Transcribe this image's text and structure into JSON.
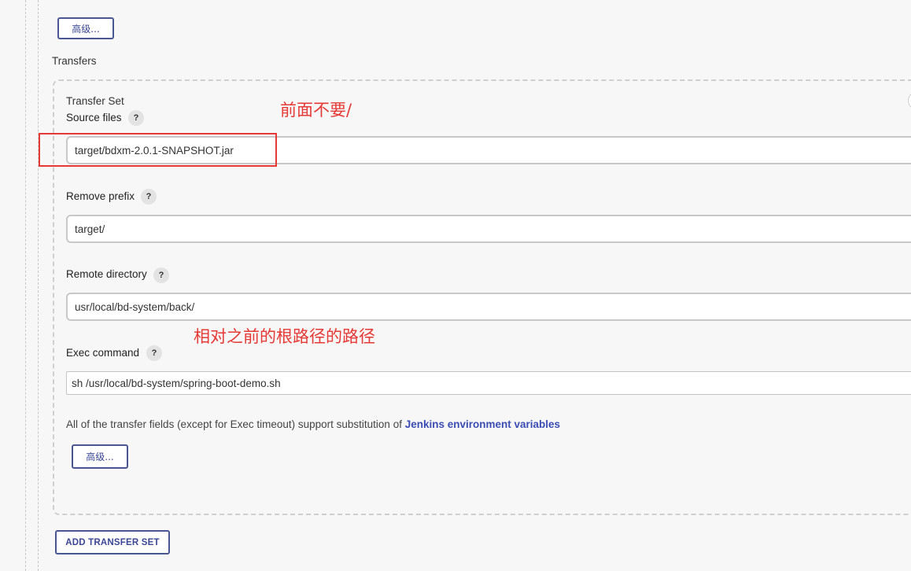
{
  "top": {
    "advanced_label": "高级..."
  },
  "transfers": {
    "title": "Transfers",
    "set": {
      "title": "Transfer Set",
      "source_files": {
        "label": "Source files",
        "help": "?",
        "value": "target/bdxm-2.0.1-SNAPSHOT.jar"
      },
      "remove_prefix": {
        "label": "Remove prefix",
        "help": "?",
        "value": "target/"
      },
      "remote_directory": {
        "label": "Remote directory",
        "help": "?",
        "value": "usr/local/bd-system/back/"
      },
      "exec_command": {
        "label": "Exec command",
        "help": "?",
        "value": "sh /usr/local/bd-system/spring-boot-demo.sh"
      },
      "note": {
        "text": "All of the transfer fields (except for Exec timeout) support substitution of ",
        "link": "Jenkins environment variables"
      },
      "advanced_label": "高级..."
    },
    "add_label": "ADD TRANSFER SET"
  },
  "annotations": {
    "source_note": "前面不要/",
    "remote_note": "相对之前的根路径的路径",
    "color": "#e53935"
  }
}
